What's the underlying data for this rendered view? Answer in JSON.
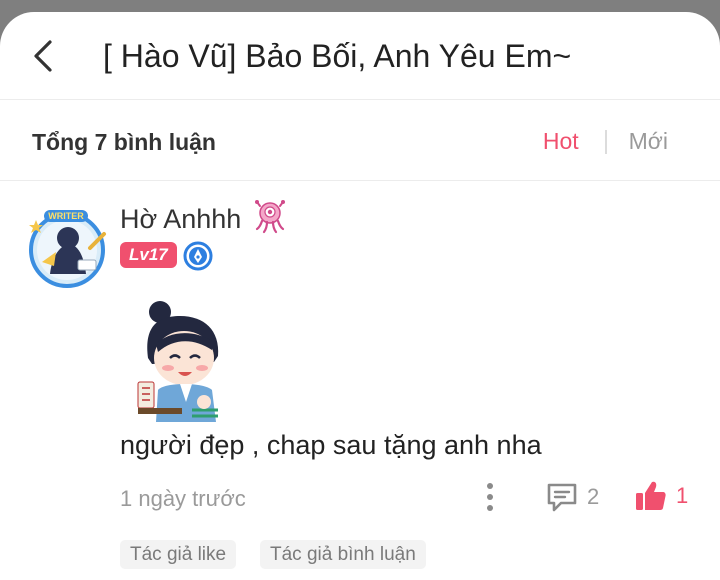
{
  "header": {
    "title": "[ Hào Vũ] Bảo Bối, Anh Yêu Em~",
    "back_icon": "chevron-left-icon"
  },
  "comments_bar": {
    "total": "Tổng 7 bình luận",
    "sort_hot": "Hot",
    "sort_new": "Mới"
  },
  "comment": {
    "avatar_icon": "writer-avatar",
    "avatar_badge": "WRITER",
    "username": "Hờ Anhhh",
    "username_badge_icon": "pink-octopus-icon",
    "level": "Lv17",
    "medal_icon": "blue-pen-medal-icon",
    "sticker_icon": "chibi-sticker",
    "text": "người đẹp , chap sau tặng anh nha",
    "time": "1 ngày trước",
    "reply_count": "2",
    "like_count": "1",
    "tags": [
      "Tác giả like",
      "Tác giả bình luận"
    ]
  },
  "colors": {
    "accent": "#f0506e",
    "muted": "#9a9a9a",
    "medal": "#2d7fe0"
  }
}
